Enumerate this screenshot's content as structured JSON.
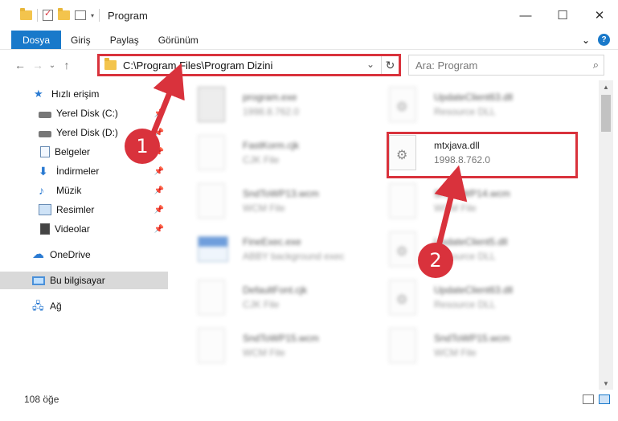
{
  "window": {
    "title": "Program",
    "minimize": "—",
    "maximize": "☐",
    "close": "✕"
  },
  "ribbon": {
    "tabs": [
      "Dosya",
      "Giriş",
      "Paylaş",
      "Görünüm"
    ],
    "expand": "⌄",
    "help": "?"
  },
  "nav": {
    "back": "←",
    "forward": "→",
    "recent": "⌄",
    "up": "↑"
  },
  "address": {
    "path": "C:\\Program Files\\Program Dizini",
    "dropdown": "⌄",
    "refresh": "↻"
  },
  "search": {
    "placeholder": "Ara: Program",
    "icon": "⌕"
  },
  "sidebar": {
    "items": [
      {
        "label": "Hızlı erişim",
        "icon": "star-icon"
      },
      {
        "label": "Yerel Disk (C:)",
        "icon": "drive-icon",
        "pin": "📌"
      },
      {
        "label": "Yerel Disk (D:)",
        "icon": "drive-icon",
        "pin": "📌"
      },
      {
        "label": "Belgeler",
        "icon": "document-icon",
        "pin": "📌"
      },
      {
        "label": "İndirmeler",
        "icon": "download-icon",
        "pin": "📌"
      },
      {
        "label": "Müzik",
        "icon": "music-icon",
        "pin": "📌"
      },
      {
        "label": "Resimler",
        "icon": "pictures-icon",
        "pin": "📌"
      },
      {
        "label": "Videolar",
        "icon": "video-icon",
        "pin": "📌"
      },
      {
        "label": "OneDrive",
        "icon": "cloud-icon"
      },
      {
        "label": "Bu bilgisayar",
        "icon": "computer-icon"
      },
      {
        "label": "Ağ",
        "icon": "network-icon"
      }
    ]
  },
  "files": [
    {
      "name": "program.exe",
      "sub": "1998.8.762.0",
      "icon": "exe-icon"
    },
    {
      "name": "UpdateClient63.dll",
      "sub": "Resource DLL",
      "icon": "dll-icon"
    },
    {
      "name": "FastKorm.cjk",
      "sub": "CJK File",
      "icon": "file-icon"
    },
    {
      "name": "mtxjava.dll",
      "sub": "1998.8.762.0",
      "icon": "dll-icon"
    },
    {
      "name": "SndToWP13.wcm",
      "sub": "WCM File",
      "icon": "file-icon"
    },
    {
      "name": "SndToWP14.wcm",
      "sub": "WCM File",
      "icon": "file-icon"
    },
    {
      "name": "FineExec.exe",
      "sub": "ABBY background exec",
      "icon": "app-icon"
    },
    {
      "name": "UpdateClient5.dll",
      "sub": "Resource DLL",
      "icon": "dll-icon"
    },
    {
      "name": "DefaultFont.cjk",
      "sub": "CJK File",
      "icon": "file-icon"
    },
    {
      "name": "UpdateClient63.dll",
      "sub": "Resource DLL",
      "icon": "dll-icon"
    },
    {
      "name": "SndToWP15.wcm",
      "sub": "WCM File",
      "icon": "file-icon"
    },
    {
      "name": "SndToWP15.wcm",
      "sub": "WCM File",
      "icon": "file-icon"
    }
  ],
  "status": {
    "count": "108 öğe"
  },
  "annotations": {
    "step1": "1",
    "step2": "2",
    "color": "#d9323c"
  }
}
